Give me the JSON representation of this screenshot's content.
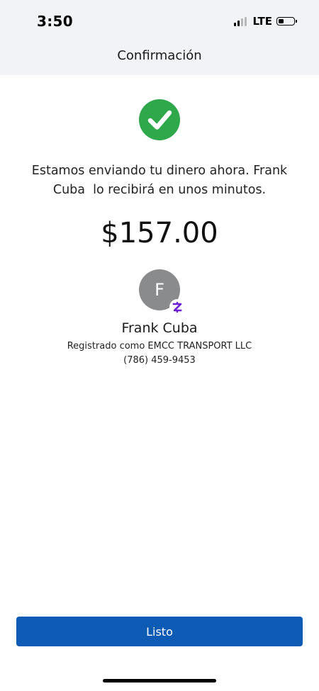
{
  "status_bar": {
    "time": "3:50",
    "network": "LTE",
    "signal_bars_active": 2,
    "signal_bars_total": 4,
    "battery_level": 0.35
  },
  "nav": {
    "title": "Confirmación"
  },
  "confirmation": {
    "icon": "checkmark-circle-icon",
    "icon_color": "#2ea84a",
    "message": "Estamos enviando tu dinero ahora. Frank\nCuba  lo recibirá en unos minutos.",
    "amount": "$157.00"
  },
  "recipient": {
    "avatar_initial": "F",
    "badge_icon": "zelle-icon",
    "badge_color": "#6d1ed4",
    "name": "Frank Cuba",
    "registered_as": "Registrado como EMCC TRANSPORT LLC",
    "phone": "(786) 459-9453"
  },
  "actions": {
    "done_label": "Listo",
    "done_color": "#0d5bb4"
  }
}
